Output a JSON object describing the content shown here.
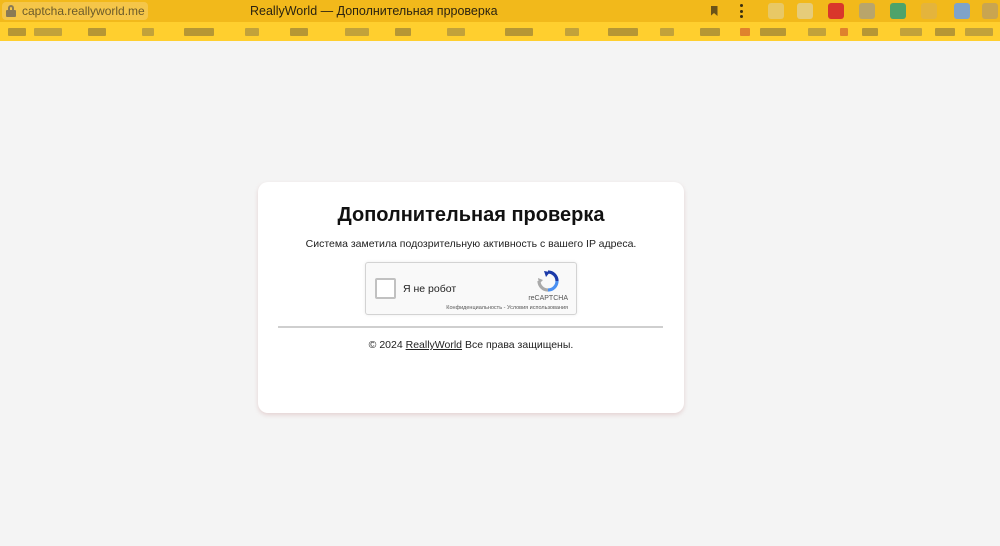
{
  "browser": {
    "url": "captcha.reallyworld.me",
    "window_title": "ReallyWorld — Дополнительная прроверка"
  },
  "page": {
    "title": "Дополнительная проверка",
    "subtitle": "Система заметила подозрительную активность с вашего IP адреса.",
    "recaptcha": {
      "checkbox_label": "Я не робот",
      "brand": "reCAPTCHA",
      "privacy_link": "Конфиденциальность",
      "link_separator": " - ",
      "terms_link": "Условия использования"
    },
    "footer": {
      "prefix": "© 2024 ",
      "brand_link": "ReallyWorld",
      "suffix": " Все права защищены."
    }
  },
  "colors": {
    "toolbar": "#f2b91b",
    "bookmarks_bar": "#ffcf2e",
    "page_background": "#f4f4f4"
  }
}
